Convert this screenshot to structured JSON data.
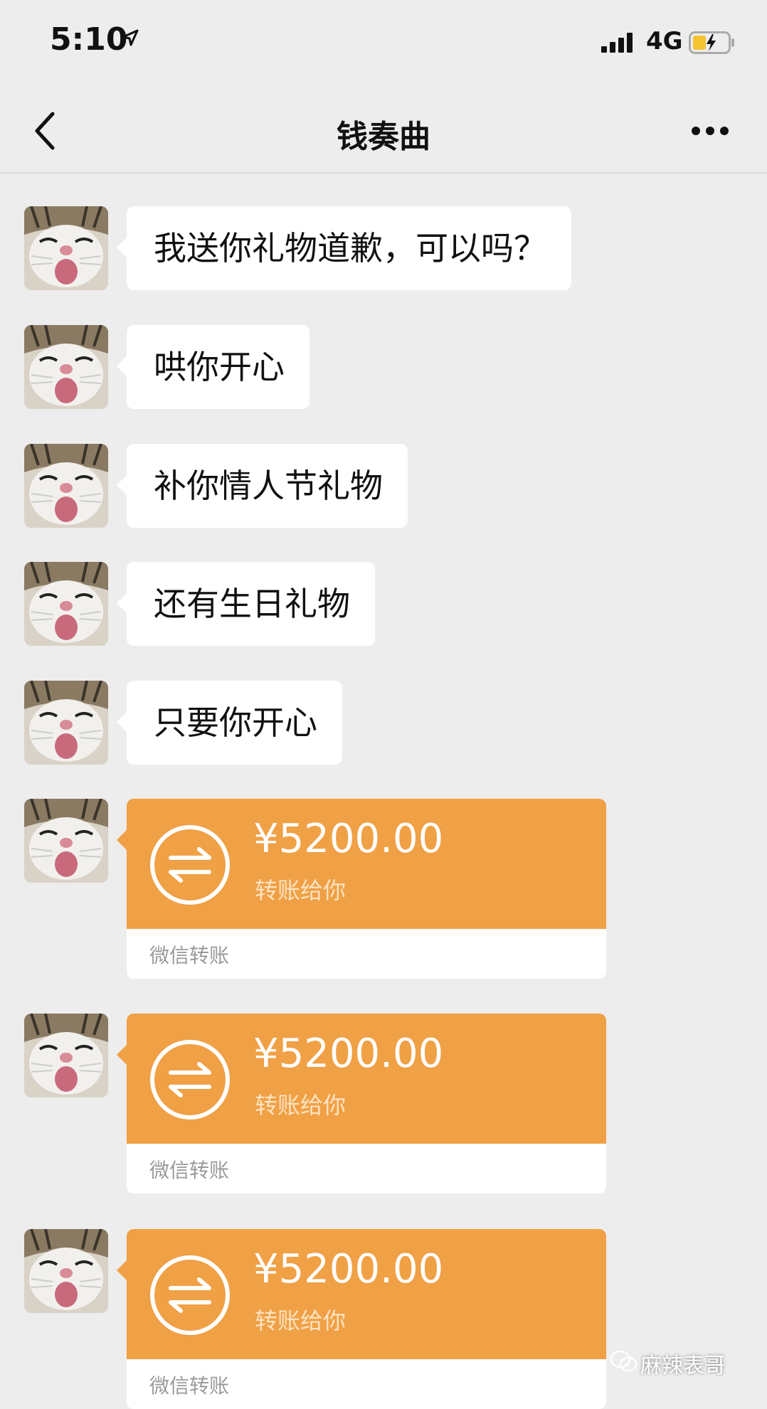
{
  "status": {
    "time": "5:10",
    "network": "4G"
  },
  "nav": {
    "title": "钱奏曲"
  },
  "messages": [
    {
      "text": "我送你礼物道歉，可以吗？"
    },
    {
      "text": "哄你开心"
    },
    {
      "text": "补你情人节礼物"
    },
    {
      "text": "还有生日礼物"
    },
    {
      "text": "只要你开心"
    }
  ],
  "transfers": [
    {
      "amount": "¥5200.00",
      "desc": "转账给你",
      "label": "微信转账"
    },
    {
      "amount": "¥5200.00",
      "desc": "转账给你",
      "label": "微信转账"
    },
    {
      "amount": "¥5200.00",
      "desc": "转账给你",
      "label": "微信转账"
    }
  ],
  "watermark": {
    "text": "麻辣表哥"
  },
  "colors": {
    "background": "#ededed",
    "transfer": "#f0a045",
    "bubble": "#ffffff"
  },
  "icons": [
    "location-arrow-icon",
    "signal-icon",
    "battery-charging-icon",
    "back-chevron-icon",
    "more-dots-icon",
    "transfer-arrows-icon",
    "wechat-logo-icon"
  ]
}
